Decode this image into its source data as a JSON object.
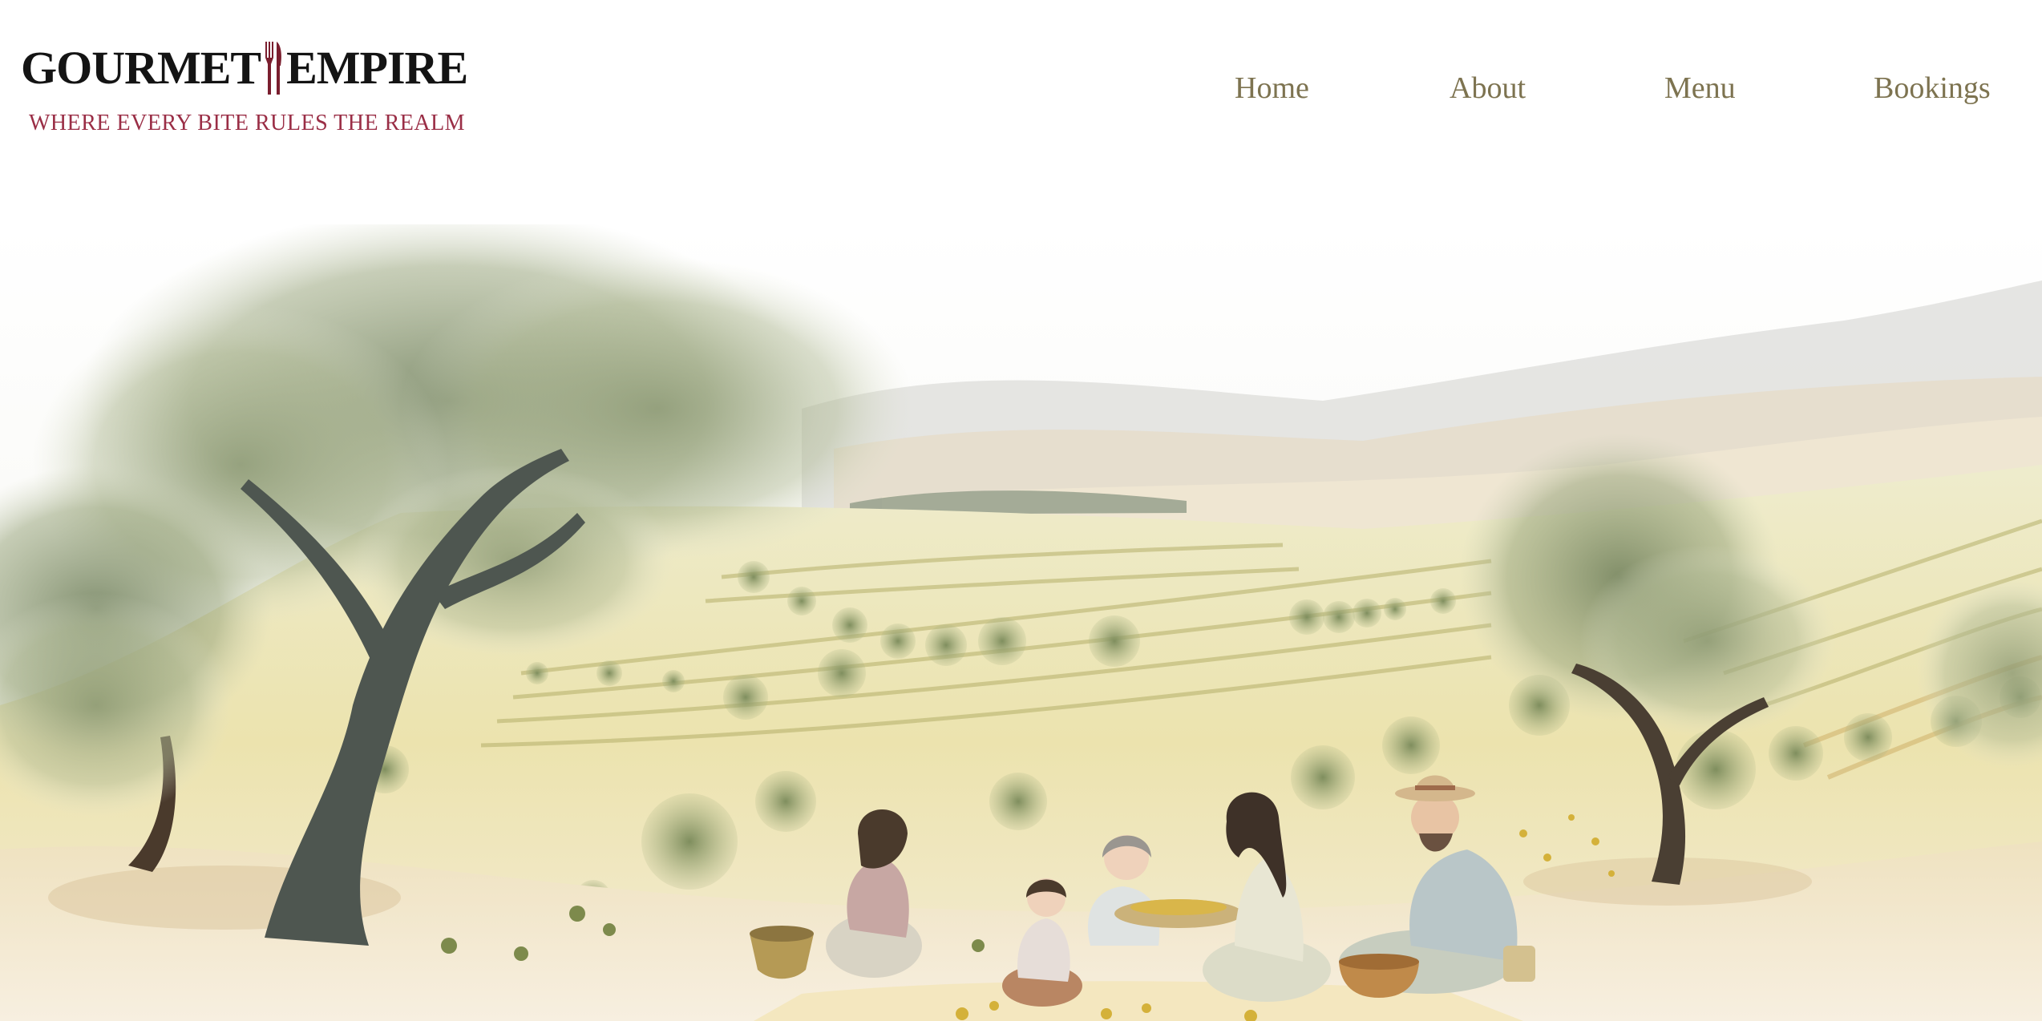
{
  "brand": {
    "name_left": "GOURMET",
    "name_right": "EMPIRE",
    "tagline": "WHERE EVERY BITE RULES THE REALM",
    "tagline_color": "#9a2e46"
  },
  "nav": {
    "items": [
      {
        "label": "Home"
      },
      {
        "label": "About"
      },
      {
        "label": "Menu"
      },
      {
        "label": "Bookings"
      }
    ],
    "color": "#7d7350"
  },
  "hero": {
    "image": "watercolor-olive-grove-family-picnic"
  }
}
